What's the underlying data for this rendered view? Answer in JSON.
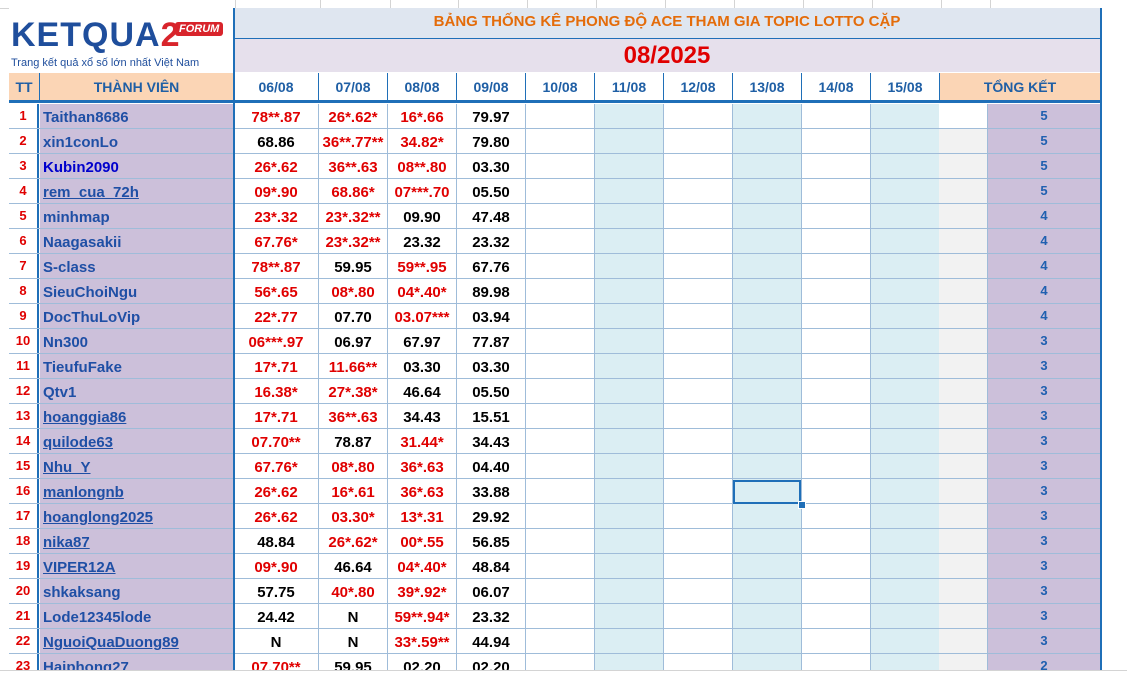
{
  "header": {
    "logo_brand_left": "KET",
    "logo_brand_mid": "QUA",
    "logo_brand_num": "2",
    "logo_forum": "FORUM",
    "logo_tagline": "Trang kết quả xổ số lớn nhất Việt Nam",
    "title": "BẢNG THỐNG KÊ PHONG ĐỘ ACE THAM GIA TOPIC  LOTTO CẶP",
    "month": "08/2025"
  },
  "columns": {
    "tt": "TT",
    "member": "THÀNH VIÊN",
    "days": [
      "06/08",
      "07/08",
      "08/08",
      "09/08",
      "10/08",
      "11/08",
      "12/08",
      "13/08",
      "14/08",
      "15/08"
    ],
    "total": "TỔNG KẾT"
  },
  "colors": {
    "accent_blue": "#1f6fb8",
    "hit_red": "#e00000",
    "name_purple_bg": "#ccc0da",
    "title_orange": "#e46c0a"
  },
  "rows": [
    {
      "tt": "1",
      "name": "Taithan8686",
      "link": false,
      "bright": false,
      "d": [
        [
          "78**.87",
          "red"
        ],
        [
          "26*.62*",
          "red"
        ],
        [
          "16*.66",
          "red"
        ],
        [
          "79.97",
          "black"
        ]
      ],
      "total": "5"
    },
    {
      "tt": "2",
      "name": "xin1conLo",
      "link": false,
      "bright": false,
      "d": [
        [
          "68.86",
          "black"
        ],
        [
          "36**.77**",
          "red"
        ],
        [
          "34.82*",
          "red"
        ],
        [
          "79.80",
          "black"
        ]
      ],
      "total": "5"
    },
    {
      "tt": "3",
      "name": "Kubin2090",
      "link": false,
      "bright": true,
      "d": [
        [
          "26*.62",
          "red"
        ],
        [
          "36**.63",
          "red"
        ],
        [
          "08**.80",
          "red"
        ],
        [
          "03.30",
          "black"
        ]
      ],
      "total": "5"
    },
    {
      "tt": "4",
      "name": "rem_cua_72h",
      "link": true,
      "bright": false,
      "d": [
        [
          "09*.90",
          "red"
        ],
        [
          "68.86*",
          "red"
        ],
        [
          "07***.70",
          "red"
        ],
        [
          "05.50",
          "black"
        ]
      ],
      "total": "5"
    },
    {
      "tt": "5",
      "name": "minhmap",
      "link": false,
      "bright": false,
      "d": [
        [
          "23*.32",
          "red"
        ],
        [
          "23*.32**",
          "red"
        ],
        [
          "09.90",
          "black"
        ],
        [
          "47.48",
          "black"
        ]
      ],
      "total": "4"
    },
    {
      "tt": "6",
      "name": "Naagasakii",
      "link": false,
      "bright": false,
      "d": [
        [
          "67.76*",
          "red"
        ],
        [
          "23*.32**",
          "red"
        ],
        [
          "23.32",
          "black"
        ],
        [
          "23.32",
          "black"
        ]
      ],
      "total": "4"
    },
    {
      "tt": "7",
      "name": "S-class",
      "link": false,
      "bright": false,
      "d": [
        [
          "78**.87",
          "red"
        ],
        [
          "59.95",
          "black"
        ],
        [
          "59**.95",
          "red"
        ],
        [
          "67.76",
          "black"
        ]
      ],
      "total": "4"
    },
    {
      "tt": "8",
      "name": "SieuChoiNgu",
      "link": false,
      "bright": false,
      "d": [
        [
          "56*.65",
          "red"
        ],
        [
          "08*.80",
          "red"
        ],
        [
          "04*.40*",
          "red"
        ],
        [
          "89.98",
          "black"
        ]
      ],
      "total": "4"
    },
    {
      "tt": "9",
      "name": "DocThuLoVip",
      "link": false,
      "bright": false,
      "d": [
        [
          "22*.77",
          "red"
        ],
        [
          "07.70",
          "black"
        ],
        [
          "03.07***",
          "red"
        ],
        [
          "03.94",
          "black"
        ]
      ],
      "total": "4"
    },
    {
      "tt": "10",
      "name": "Nn300",
      "link": false,
      "bright": false,
      "d": [
        [
          "06***.97",
          "red"
        ],
        [
          "06.97",
          "black"
        ],
        [
          "67.97",
          "black"
        ],
        [
          "77.87",
          "black"
        ]
      ],
      "total": "3"
    },
    {
      "tt": "11",
      "name": "TieufuFake",
      "link": false,
      "bright": false,
      "d": [
        [
          "17*.71",
          "red"
        ],
        [
          "11.66**",
          "red"
        ],
        [
          "03.30",
          "black"
        ],
        [
          "03.30",
          "black"
        ]
      ],
      "total": "3"
    },
    {
      "tt": "12",
      "name": "Qtv1",
      "link": false,
      "bright": false,
      "d": [
        [
          "16.38*",
          "red"
        ],
        [
          "27*.38*",
          "red"
        ],
        [
          "46.64",
          "black"
        ],
        [
          "05.50",
          "black"
        ]
      ],
      "total": "3"
    },
    {
      "tt": "13",
      "name": "hoanggia86",
      "link": true,
      "bright": false,
      "d": [
        [
          "17*.71",
          "red"
        ],
        [
          "36**.63",
          "red"
        ],
        [
          "34.43",
          "black"
        ],
        [
          "15.51",
          "black"
        ]
      ],
      "total": "3"
    },
    {
      "tt": "14",
      "name": "quilode63",
      "link": true,
      "bright": false,
      "d": [
        [
          "07.70**",
          "red"
        ],
        [
          "78.87",
          "black"
        ],
        [
          "31.44*",
          "red"
        ],
        [
          "34.43",
          "black"
        ]
      ],
      "total": "3"
    },
    {
      "tt": "15",
      "name": "Nhu_Y",
      "link": true,
      "bright": false,
      "d": [
        [
          "67.76*",
          "red"
        ],
        [
          "08*.80",
          "red"
        ],
        [
          "36*.63",
          "red"
        ],
        [
          "04.40",
          "black"
        ]
      ],
      "total": "3"
    },
    {
      "tt": "16",
      "name": "manlongnb",
      "link": true,
      "bright": false,
      "d": [
        [
          "26*.62",
          "red"
        ],
        [
          "16*.61",
          "red"
        ],
        [
          "36*.63",
          "red"
        ],
        [
          "33.88",
          "black"
        ]
      ],
      "total": "3"
    },
    {
      "tt": "17",
      "name": "hoanglong2025",
      "link": true,
      "bright": false,
      "d": [
        [
          "26*.62",
          "red"
        ],
        [
          "03.30*",
          "red"
        ],
        [
          "13*.31",
          "red"
        ],
        [
          "29.92",
          "black"
        ]
      ],
      "total": "3"
    },
    {
      "tt": "18",
      "name": "nika87",
      "link": true,
      "bright": false,
      "d": [
        [
          "48.84",
          "black"
        ],
        [
          "26*.62*",
          "red"
        ],
        [
          "00*.55",
          "red"
        ],
        [
          "56.85",
          "black"
        ]
      ],
      "total": "3"
    },
    {
      "tt": "19",
      "name": "VIPER12A",
      "link": true,
      "bright": false,
      "d": [
        [
          "09*.90",
          "red"
        ],
        [
          "46.64",
          "black"
        ],
        [
          "04*.40*",
          "red"
        ],
        [
          "48.84",
          "black"
        ]
      ],
      "total": "3"
    },
    {
      "tt": "20",
      "name": "shkaksang",
      "link": false,
      "bright": false,
      "d": [
        [
          "57.75",
          "black"
        ],
        [
          "40*.80",
          "red"
        ],
        [
          "39*.92*",
          "red"
        ],
        [
          "06.07",
          "black"
        ]
      ],
      "total": "3"
    },
    {
      "tt": "21",
      "name": "Lode12345lode",
      "link": false,
      "bright": false,
      "d": [
        [
          "24.42",
          "black"
        ],
        [
          "N",
          "black"
        ],
        [
          "59**.94*",
          "red"
        ],
        [
          "23.32",
          "black"
        ]
      ],
      "total": "3"
    },
    {
      "tt": "22",
      "name": "NguoiQuaDuong89",
      "link": true,
      "bright": false,
      "d": [
        [
          "N",
          "black"
        ],
        [
          "N",
          "black"
        ],
        [
          "33*.59**",
          "red"
        ],
        [
          "44.94",
          "black"
        ]
      ],
      "total": "3"
    },
    {
      "tt": "23",
      "name": "Haiphong27",
      "link": true,
      "bright": false,
      "d": [
        [
          "07.70**",
          "red"
        ],
        [
          "59.95",
          "black"
        ],
        [
          "02.20",
          "black"
        ],
        [
          "02.20",
          "black"
        ]
      ],
      "total": "2"
    }
  ]
}
